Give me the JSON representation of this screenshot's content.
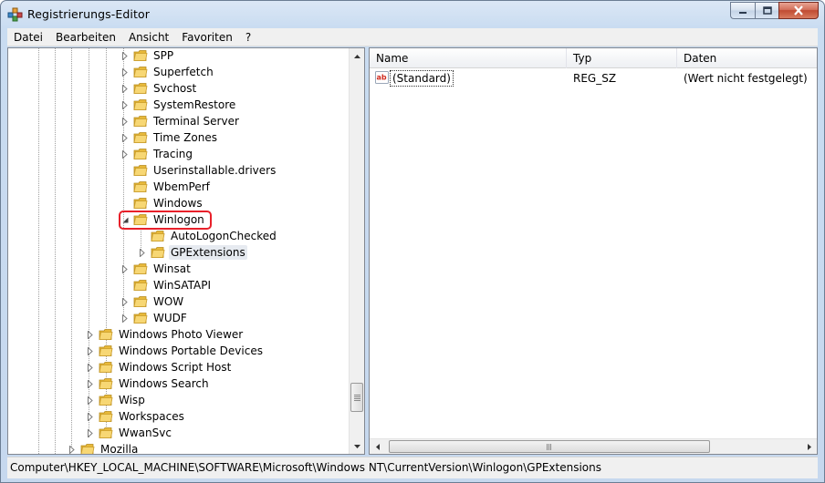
{
  "window": {
    "title": "Registrierungs-Editor"
  },
  "menu": [
    "Datei",
    "Bearbeiten",
    "Ansicht",
    "Favoriten",
    "?"
  ],
  "tree": {
    "items": [
      {
        "label": "SPP",
        "expander": "collapsed"
      },
      {
        "label": "Superfetch",
        "expander": "collapsed"
      },
      {
        "label": "Svchost",
        "expander": "collapsed"
      },
      {
        "label": "SystemRestore",
        "expander": "collapsed"
      },
      {
        "label": "Terminal Server",
        "expander": "collapsed"
      },
      {
        "label": "Time Zones",
        "expander": "collapsed"
      },
      {
        "label": "Tracing",
        "expander": "collapsed"
      },
      {
        "label": "Userinstallable.drivers",
        "expander": "none"
      },
      {
        "label": "WbemPerf",
        "expander": "none"
      },
      {
        "label": "Windows",
        "expander": "none"
      },
      {
        "label": "Winlogon",
        "expander": "expanded"
      },
      {
        "label": "AutoLogonChecked",
        "expander": "none"
      },
      {
        "label": "GPExtensions",
        "expander": "collapsed",
        "selected": true
      },
      {
        "label": "Winsat",
        "expander": "collapsed"
      },
      {
        "label": "WinSATAPI",
        "expander": "none"
      },
      {
        "label": "WOW",
        "expander": "collapsed"
      },
      {
        "label": "WUDF",
        "expander": "collapsed"
      },
      {
        "label": "Windows Photo Viewer",
        "expander": "collapsed"
      },
      {
        "label": "Windows Portable Devices",
        "expander": "collapsed"
      },
      {
        "label": "Windows Script Host",
        "expander": "collapsed"
      },
      {
        "label": "Windows Search",
        "expander": "collapsed"
      },
      {
        "label": "Wisp",
        "expander": "collapsed"
      },
      {
        "label": "Workspaces",
        "expander": "collapsed"
      },
      {
        "label": "WwanSvc",
        "expander": "collapsed"
      },
      {
        "label": "Mozilla",
        "expander": "collapsed"
      }
    ]
  },
  "list": {
    "columns": {
      "name": "Name",
      "type": "Typ",
      "data": "Daten"
    },
    "rows": [
      {
        "name": "(Standard)",
        "type": "REG_SZ",
        "data": "(Wert nicht festgelegt)",
        "icon": "string-value-icon"
      }
    ]
  },
  "statusbar": {
    "path": "Computer\\HKEY_LOCAL_MACHINE\\SOFTWARE\\Microsoft\\Windows NT\\CurrentVersion\\Winlogon\\GPExtensions"
  },
  "scrollbars": {
    "horizontal_grip": "III"
  },
  "colors": {
    "highlight": "#e8202a",
    "folder": "#f2c94c",
    "close_button": "#c04a31"
  }
}
